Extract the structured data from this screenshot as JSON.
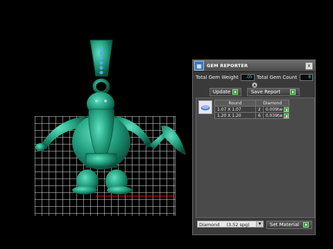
{
  "panel": {
    "title": "GEM REPORTER",
    "close": "x",
    "total_weight_label": "Total Gem Weight",
    "total_weight_value": ".05",
    "total_count_label": "Total Gem Count",
    "total_count_value": "8",
    "update_label": "Update",
    "save_report_label": "Save Report",
    "table": {
      "headers": [
        "Round",
        "Diamond"
      ],
      "rows": [
        {
          "size": "1.07 X 1.07",
          "count": "2",
          "weight": "0.009tw"
        },
        {
          "size": "1.20 X 1.20",
          "count": "6",
          "weight": "0.039tw"
        }
      ]
    },
    "material_select": "Diamond",
    "material_spg": "(3.52 spg)",
    "set_material_label": "Set Material"
  },
  "colors": {
    "model": "#1f9a78",
    "accent_value": "#28d8d8",
    "play_button": "#2fa02f"
  },
  "icons": [
    "app-icon",
    "close-icon",
    "play-icon",
    "gem-thumbnail-icon",
    "dropdown-arrow-icon"
  ]
}
